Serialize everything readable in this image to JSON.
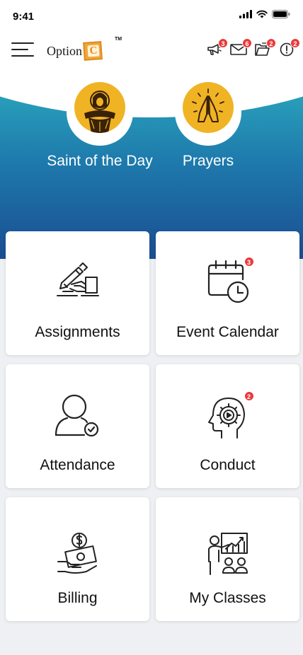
{
  "status": {
    "time": "9:41"
  },
  "header": {
    "logo_text": "Option",
    "logo_letter": "C",
    "logo_tm": "TM",
    "actions": [
      {
        "icon": "megaphone-icon",
        "badge": "3"
      },
      {
        "icon": "mail-icon",
        "badge": "6"
      },
      {
        "icon": "folder-icon",
        "badge": "2"
      },
      {
        "icon": "alert-icon",
        "badge": "2"
      }
    ]
  },
  "hero": {
    "items": [
      {
        "label": "Saint of the Day",
        "icon": "saint-icon"
      },
      {
        "label": "Prayers",
        "icon": "praying-hands-icon"
      }
    ]
  },
  "tiles": [
    {
      "label": "Assignments",
      "icon": "assignment-icon",
      "badge": ""
    },
    {
      "label": "Event Calendar",
      "icon": "calendar-icon",
      "badge": "3"
    },
    {
      "label": "Attendance",
      "icon": "attendance-icon",
      "badge": ""
    },
    {
      "label": "Conduct",
      "icon": "conduct-icon",
      "badge": "2"
    },
    {
      "label": "Billing",
      "icon": "billing-icon",
      "badge": ""
    },
    {
      "label": "My Classes",
      "icon": "classroom-icon",
      "badge": ""
    }
  ],
  "colors": {
    "accent": "#1e7aac",
    "hero_top": "#2ba6bd",
    "hero_bottom": "#1a4d91",
    "badge": "#e93b3b",
    "icon_yellow": "#f0b324"
  }
}
